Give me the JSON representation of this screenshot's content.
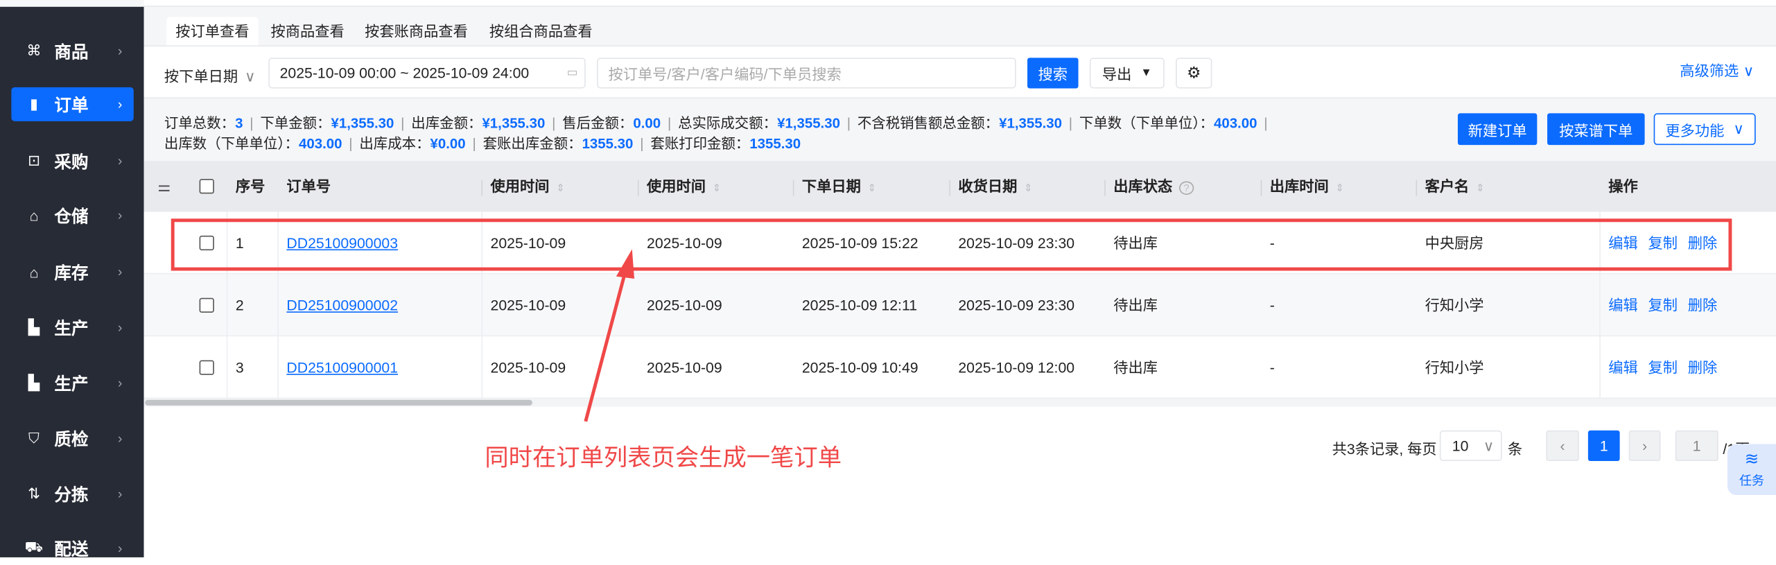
{
  "sidebar": {
    "items": [
      {
        "label": "商品",
        "icon": "grid-icon"
      },
      {
        "label": "订单",
        "icon": "clipboard-icon",
        "active": true
      },
      {
        "label": "采购",
        "icon": "bag-icon"
      },
      {
        "label": "仓储",
        "icon": "house-icon"
      },
      {
        "label": "库存",
        "icon": "house-icon"
      },
      {
        "label": "生产",
        "icon": "factory-icon"
      },
      {
        "label": "生产",
        "icon": "factory-icon"
      },
      {
        "label": "质检",
        "icon": "shield-icon"
      },
      {
        "label": "分拣",
        "icon": "sort-icon"
      },
      {
        "label": "配送",
        "icon": "truck-icon"
      }
    ]
  },
  "tabs": [
    "按订单查看",
    "按商品查看",
    "按套账商品查看",
    "按组合商品查看"
  ],
  "filter": {
    "date_type": "按下单日期",
    "date_range": "2025-10-09 00:00 ~ 2025-10-09 24:00",
    "search_placeholder": "按订单号/客户/客户编码/下单员搜索",
    "search": "搜索",
    "export": "导出",
    "advanced": "高级筛选"
  },
  "stats": {
    "line1": [
      {
        "k": "订单总数：",
        "v": "3"
      },
      {
        "k": "下单金额：",
        "v": "¥1,355.30"
      },
      {
        "k": "出库金额：",
        "v": "¥1,355.30"
      },
      {
        "k": "售后金额：",
        "v": "0.00"
      },
      {
        "k": "总实际成交额：",
        "v": "¥1,355.30"
      },
      {
        "k": "不含税销售额总金额：",
        "v": "¥1,355.30"
      },
      {
        "k": "下单数（下单单位）：",
        "v": "403.00"
      }
    ],
    "line2": [
      {
        "k": "出库数（下单单位）：",
        "v": "403.00"
      },
      {
        "k": "出库成本：",
        "v": "¥0.00"
      },
      {
        "k": "套账出库金额：",
        "v": "1355.30"
      },
      {
        "k": "套账打印金额：",
        "v": "1355.30"
      }
    ]
  },
  "actions": {
    "new_order": "新建订单",
    "recipe_order": "按菜谱下单",
    "more": "更多功能"
  },
  "table": {
    "headers": [
      "序号",
      "订单号",
      "使用时间",
      "使用时间",
      "下单日期",
      "收货日期",
      "出库状态",
      "出库时间",
      "客户名",
      "操作"
    ],
    "rows": [
      [
        "1",
        "DD25100900003",
        "2025-10-09",
        "2025-10-09",
        "2025-10-09 15:22",
        "2025-10-09 23:30",
        "待出库",
        "-",
        "中央厨房"
      ],
      [
        "2",
        "DD25100900002",
        "2025-10-09",
        "2025-10-09",
        "2025-10-09 12:11",
        "2025-10-09 23:30",
        "待出库",
        "-",
        "行知小学"
      ],
      [
        "3",
        "DD25100900001",
        "2025-10-09",
        "2025-10-09",
        "2025-10-09 10:49",
        "2025-10-09 12:00",
        "待出库",
        "-",
        "行知小学"
      ]
    ],
    "ops": [
      "编辑",
      "复制",
      "删除"
    ]
  },
  "pagination": {
    "total": "共3条记录, 每页",
    "page_size": "10",
    "unit": "条",
    "current": "1",
    "jump": "1",
    "pages": "/1页"
  },
  "float": {
    "task": "任务"
  },
  "annotation": {
    "text": "同时在订单列表页会生成一笔订单",
    "color": "#f04848"
  }
}
